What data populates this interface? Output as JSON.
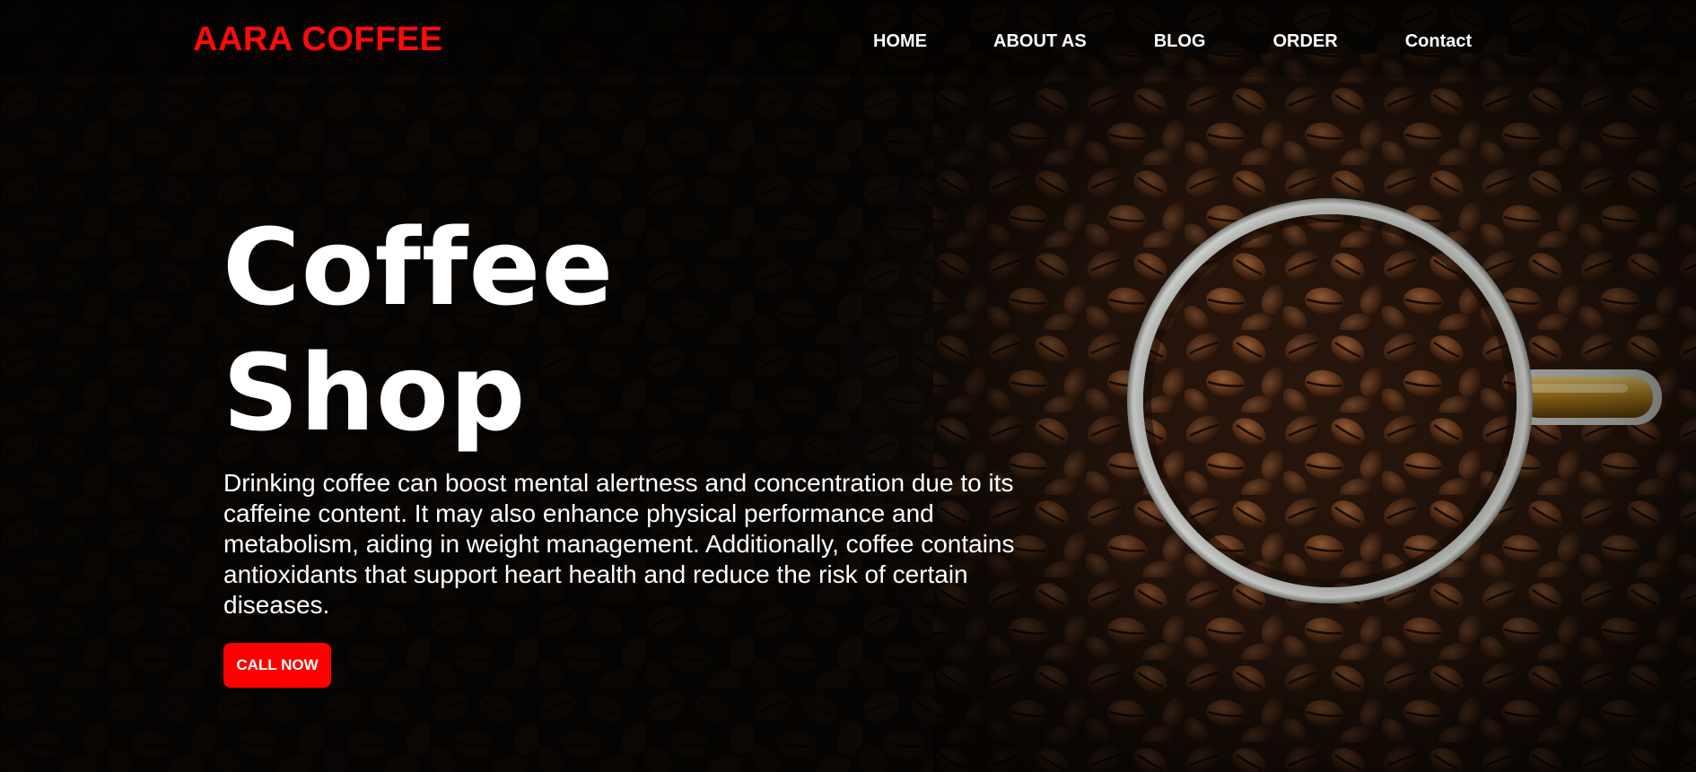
{
  "brand": {
    "name": "AARA COFFEE",
    "color": "#ff0a0a"
  },
  "nav": {
    "items": [
      {
        "label": "HOME"
      },
      {
        "label": "ABOUT AS"
      },
      {
        "label": "BLOG"
      },
      {
        "label": "ORDER"
      },
      {
        "label": "Contact"
      }
    ]
  },
  "hero": {
    "title_line1": "Coffee",
    "title_line2": "Shop",
    "description": "Drinking coffee can boost mental alertness and concentration due to its caffeine content. It may also enhance physical performance and metabolism, aiding in weight management. Additionally, coffee contains antioxidants that support heart health and reduce the risk of certain diseases.",
    "cta_label": "CALL NOW",
    "cta_color": "#ff0000"
  },
  "background": {
    "image": "coffee-beans-with-cup-photo"
  }
}
